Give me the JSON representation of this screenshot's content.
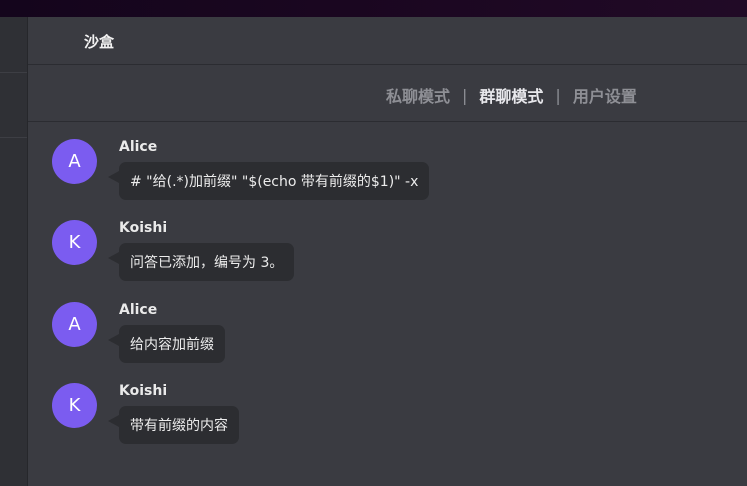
{
  "header": {
    "title": "沙盒"
  },
  "modes": {
    "items": [
      {
        "label": "私聊模式",
        "active": false
      },
      {
        "label": "群聊模式",
        "active": true
      },
      {
        "label": "用户设置",
        "active": false
      }
    ],
    "separator": "|"
  },
  "messages": [
    {
      "author": "Alice",
      "avatar_letter": "A",
      "text": "# \"给(.*)加前缀\" \"$(echo 带有前缀的$1)\" -x"
    },
    {
      "author": "Koishi",
      "avatar_letter": "K",
      "text": "问答已添加，编号为 3。"
    },
    {
      "author": "Alice",
      "avatar_letter": "A",
      "text": "给内容加前缀"
    },
    {
      "author": "Koishi",
      "avatar_letter": "K",
      "text": "带有前缀的内容"
    }
  ],
  "colors": {
    "avatar": "#7b5cf0",
    "panel": "#3a3b41",
    "bubble": "#2c2d31"
  }
}
